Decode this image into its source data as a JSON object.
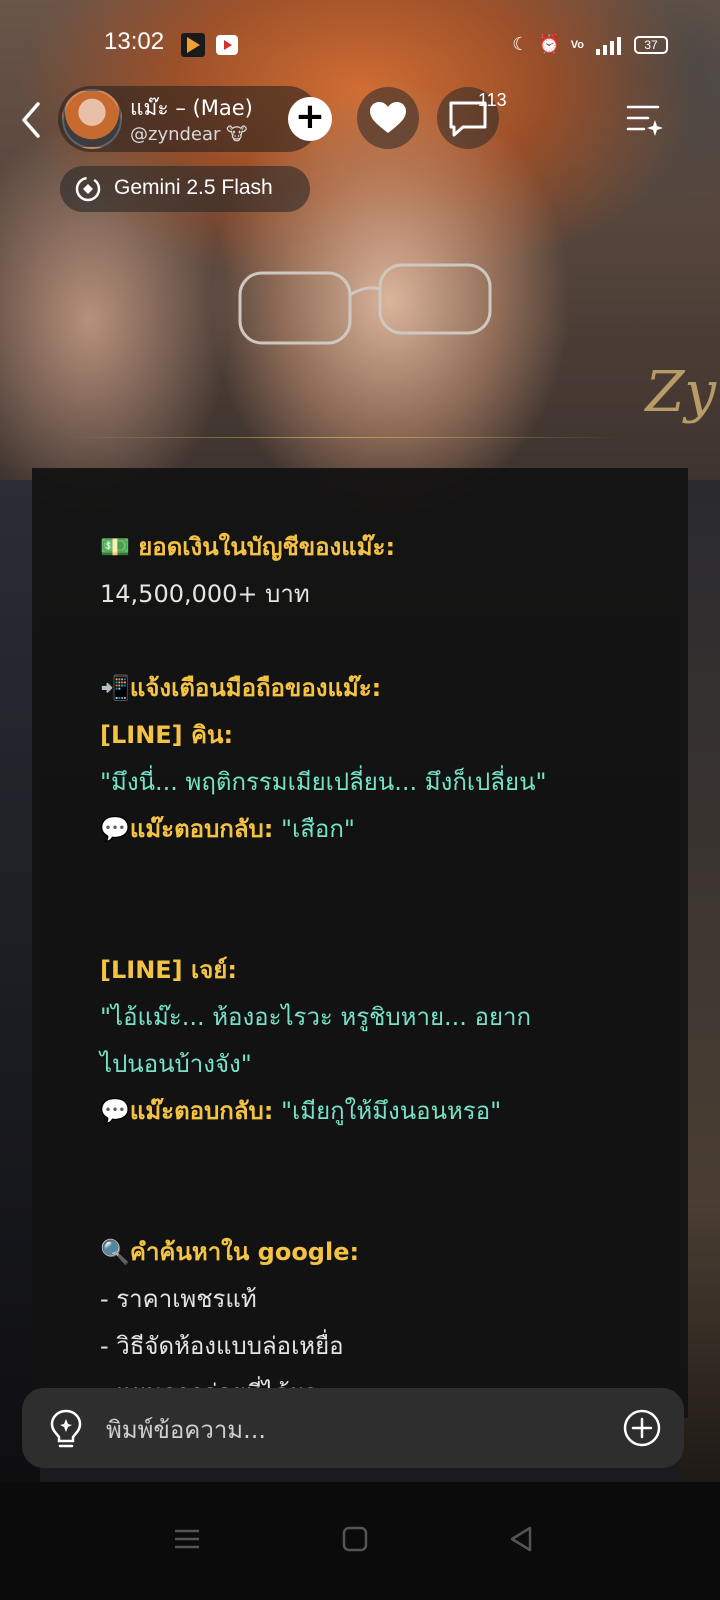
{
  "status_bar": {
    "time": "13:02",
    "battery": "37"
  },
  "header": {
    "character_name": "แม๊ะ – (Mae)",
    "handle": "@zyndear 🐮",
    "comment_count": "113",
    "model": "Gemini 2.5 Flash"
  },
  "background": {
    "signature": "Zy"
  },
  "message": {
    "balance_heading": "💵 ยอดเงินในบัญชีของแม๊ะ:",
    "balance_value": "14,500,000+ บาท",
    "notify_heading": "📲แจ้งเตือนมือถือของแม๊ะ:",
    "notif1_sender": "[LINE] คิน:",
    "notif1_text": "\"มึงนี่... พฤติกรรมเมียเปลี่ยน... มึงก็เปลี่ยน\"",
    "notif1_reply_label": "💬แม๊ะตอบกลับ:",
    "notif1_reply_text": "\"เสือก\"",
    "notif2_sender": "[LINE] เจย์:",
    "notif2_text_line1": "\"ไอ้แม๊ะ... ห้องอะไรวะ หรูชิบหาย... อยาก",
    "notif2_text_line2": "ไปนอนบ้างจัง\"",
    "notif2_reply_label": "💬แม๊ะตอบกลับ:",
    "notif2_reply_text": "\"เมียกูให้มึงนอนหรอ\"",
    "search_heading": "🔍คำค้นหาใน google:",
    "search_items": [
      "- ราคาเพชรแท้",
      "- วิธีจัดห้องแบบล่อเหยื่อ",
      "- แผนการอ่อยที่ได้ผล"
    ]
  },
  "input": {
    "placeholder": "พิมพ์ข้อความ..."
  },
  "colors": {
    "accent_gold": "#f5c343",
    "reply_mint": "#76e3c7",
    "card_bg": "#121212"
  }
}
